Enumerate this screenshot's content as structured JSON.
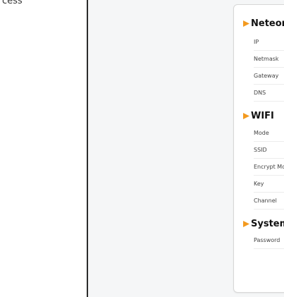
{
  "left_pane": {
    "text": "cess"
  },
  "settings": {
    "sections": [
      {
        "title": "Neteork",
        "rows": [
          "IP",
          "Netmask",
          "Gateway",
          "DNS"
        ]
      },
      {
        "title": "WIFI",
        "rows": [
          "Mode",
          "SSID",
          "Encrypt Mo",
          "Key",
          "Channel"
        ]
      },
      {
        "title": "System",
        "rows": [
          "Password"
        ]
      }
    ]
  },
  "colors": {
    "accent": "#f39a1f",
    "divider": "#2b2b2b",
    "background": "#f5f6f7"
  },
  "icons": {
    "section_marker": "play-triangle-icon"
  }
}
